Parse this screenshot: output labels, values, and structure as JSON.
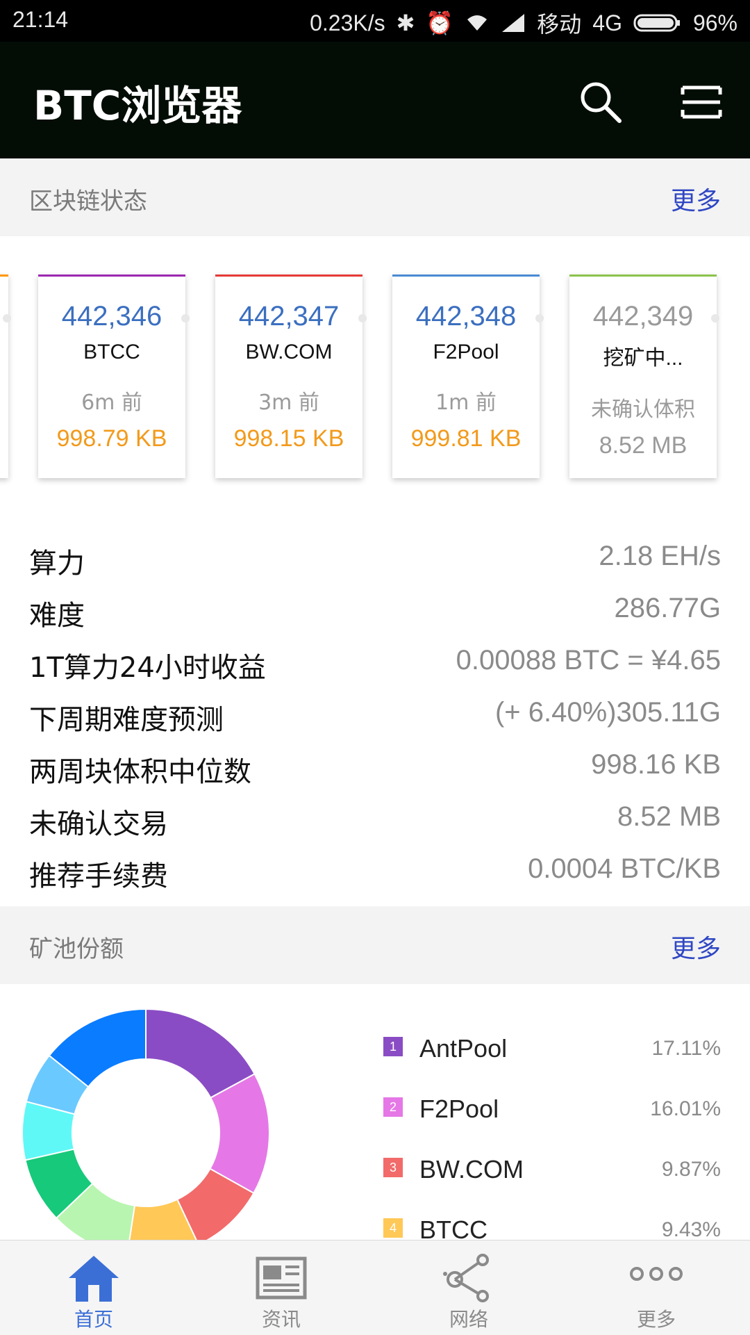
{
  "status_bar": {
    "time": "21:14",
    "speed": "0.23K/s",
    "carrier": "移动",
    "network": "4G",
    "battery": "96%"
  },
  "app_bar": {
    "title": "BTC浏览器",
    "icons": [
      "search-icon",
      "menu-icon"
    ]
  },
  "chain_section": {
    "title": "区块链状态",
    "more": "更多"
  },
  "blocks": [
    {
      "height": "442,346",
      "pool": "BTCC",
      "time": "6m 前",
      "size": "998.79 KB",
      "color": "#9c27b0"
    },
    {
      "height": "442,347",
      "pool": "BW.COM",
      "time": "3m 前",
      "size": "998.15 KB",
      "color": "#e53935"
    },
    {
      "height": "442,348",
      "pool": "F2Pool",
      "time": "1m 前",
      "size": "999.81 KB",
      "color": "#4a8ad4"
    },
    {
      "height": "442,349",
      "pool": "挖矿中...",
      "time": "未确认体积",
      "size": "8.52 MB",
      "color": "#8bc34a"
    }
  ],
  "stats": [
    {
      "label": "算力",
      "value": "2.18 EH/s"
    },
    {
      "label": "难度",
      "value": "286.77G"
    },
    {
      "label": "1T算力24小时收益",
      "value": "0.00088 BTC = ¥4.65"
    },
    {
      "label": "下周期难度预测",
      "value": "(+ 6.40%)305.11G"
    },
    {
      "label": "两周块体积中位数",
      "value": "998.16 KB"
    },
    {
      "label": "未确认交易",
      "value": "8.52 MB"
    },
    {
      "label": "推荐手续费",
      "value": "0.0004 BTC/KB"
    }
  ],
  "pool_section": {
    "title": "矿池份额",
    "more": "更多"
  },
  "chart_data": {
    "type": "pie",
    "categories": [
      "AntPool",
      "F2Pool",
      "BW.COM",
      "BTCC"
    ],
    "values": [
      17.11,
      16.01,
      9.87,
      9.43
    ],
    "colors": [
      "#8a4cc4",
      "#e578e6",
      "#f26a6a",
      "#ffc857"
    ],
    "legend_ranks": [
      "1",
      "2",
      "3",
      "4"
    ],
    "percent_labels": [
      "17.11%",
      "16.01%",
      "9.87%",
      "9.43%"
    ]
  },
  "bottom_nav": [
    {
      "label": "首页",
      "icon": "home-icon",
      "active": true
    },
    {
      "label": "资讯",
      "icon": "news-icon",
      "active": false
    },
    {
      "label": "网络",
      "icon": "network-icon",
      "active": false
    },
    {
      "label": "更多",
      "icon": "more-icon",
      "active": false
    }
  ],
  "theme": {
    "accent": "#2f47c3",
    "active_nav": "#3b6fd6",
    "inactive_nav": "#8a8a8a"
  }
}
